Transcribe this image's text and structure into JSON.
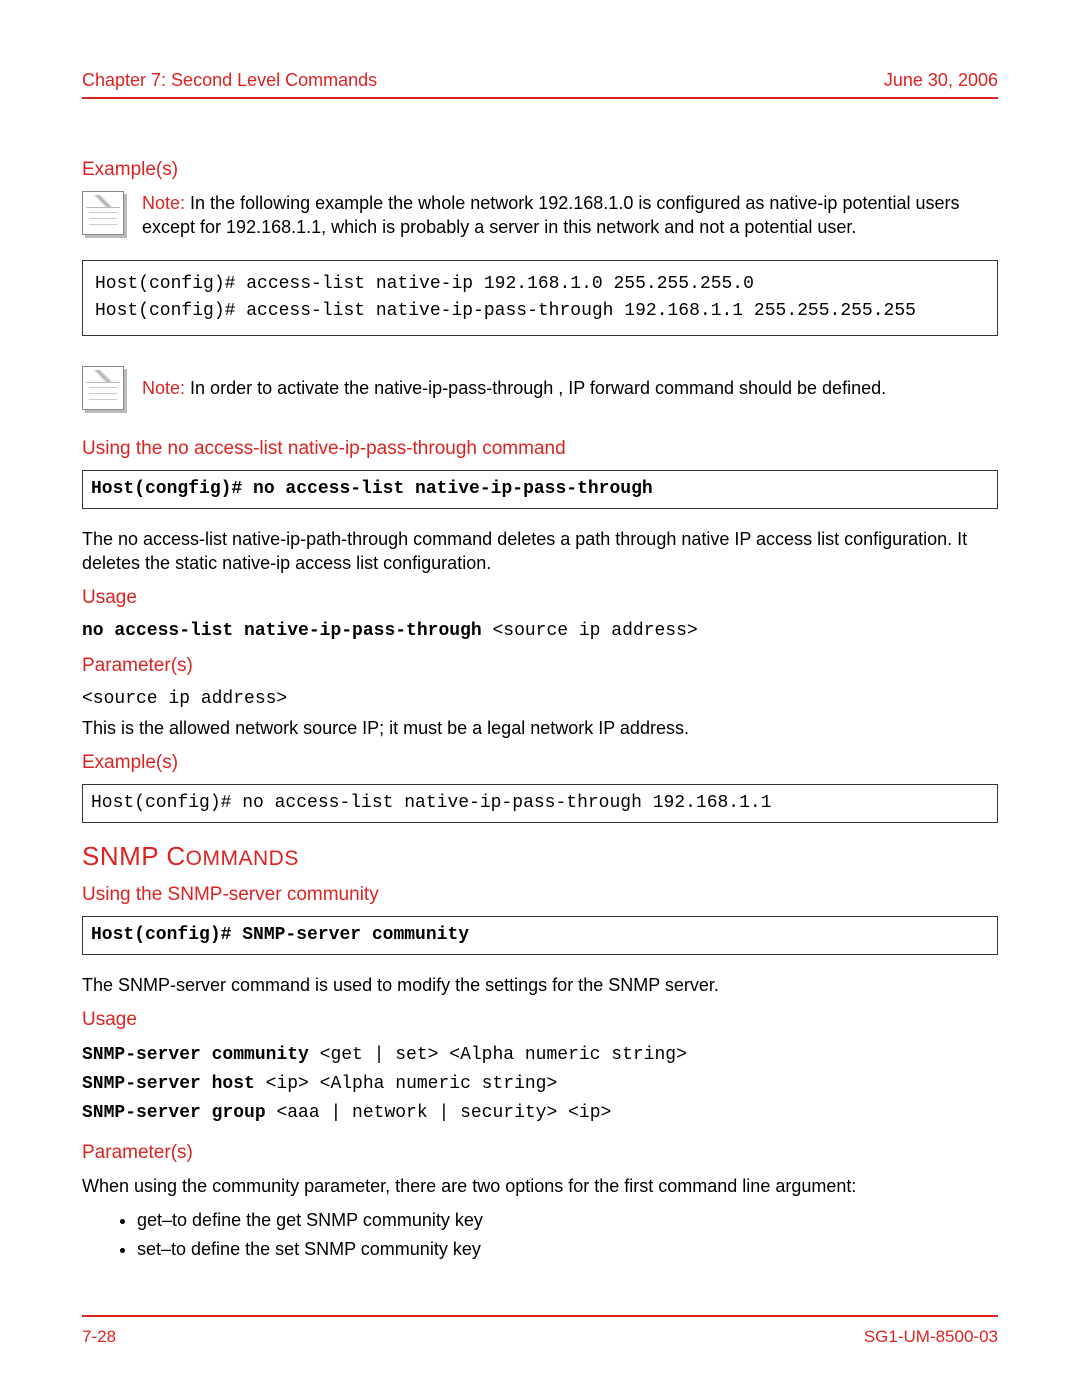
{
  "header": {
    "chapter": "Chapter 7: Second Level Commands",
    "date": "June 30, 2006"
  },
  "examples1": {
    "heading": "Example(s)",
    "noteLabel": "Note:",
    "noteText": "In the following example the whole network 192.168.1.0 is configured as native-ip potential users except for 192.168.1.1, which is probably a server in this network and not a potential user.",
    "code": "Host(config)# access-list native-ip 192.168.1.0 255.255.255.0\nHost(config)# access-list native-ip-pass-through 192.168.1.1 255.255.255.255"
  },
  "note2": {
    "label": "Note:",
    "text": "In order to activate the native-ip-pass-through    , IP forward command should be defined."
  },
  "noAccess": {
    "heading": "Using the no access-list native-ip-pass-through command",
    "syntax": "Host(congfig)# no access-list native-ip-pass-through",
    "desc": "The no access-list native-ip-path-through      command deletes a path through native IP access list configuration. It deletes the static native-ip access list configuration.",
    "usageHeading": "Usage",
    "usageBold": "no access-list native-ip-pass-through ",
    "usageRest": "<source ip address>",
    "paramsHeading": "Parameter(s)",
    "paramName": "<source ip address>",
    "paramDesc": "This is the allowed network source IP; it must be a legal network IP address.",
    "examplesHeading": "Example(s)",
    "exampleCode": "Host(config)# no access-list native-ip-pass-through 192.168.1.1"
  },
  "snmp": {
    "title1": "SNMP C",
    "title2": "OMMANDS",
    "sub": "Using the SNMP-server community",
    "syntax": "Host(config)# SNMP-server community",
    "desc": "The SNMP-server command is used to modify the settings for the SNMP server.",
    "usageHeading": "Usage",
    "u1b": "SNMP-server community ",
    "u1r": "<get | set> <Alpha numeric string>",
    "u2b": "SNMP-server host ",
    "u2r": "<ip> <Alpha numeric string>",
    "u3b": "SNMP-server group ",
    "u3r": "<aaa | network | security> <ip>",
    "paramsHeading": "Parameter(s)",
    "paramsIntro": "When using the community parameter, there are two options for the first command line argument:",
    "li1": "get–to define the get SNMP community key",
    "li2": "set–to define the set SNMP community key"
  },
  "footer": {
    "page": "7-28",
    "doc": "SG1-UM-8500-03"
  }
}
